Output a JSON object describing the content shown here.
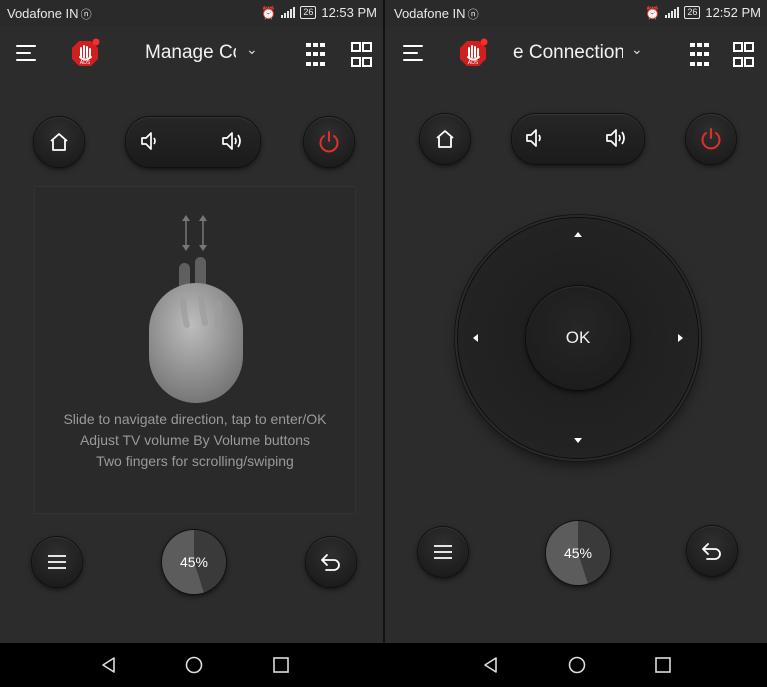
{
  "left": {
    "status": {
      "carrier": "Vodafone IN",
      "battery": "26",
      "time": "12:53 PM"
    },
    "toolbar": {
      "title": "Manage Co",
      "dropdown_icon": "chevron-down-icon"
    },
    "touchpad_hints": [
      "Slide to navigate direction, tap to enter/OK",
      "Adjust TV volume By Volume buttons",
      "Two fingers for scrolling/swiping"
    ],
    "progress": {
      "label": "45%",
      "value": 45
    }
  },
  "right": {
    "status": {
      "carrier": "Vodafone IN",
      "battery": "26",
      "time": "12:52 PM"
    },
    "toolbar": {
      "title": "e Connection",
      "dropdown_icon": "chevron-down-icon"
    },
    "dpad": {
      "ok_label": "OK"
    },
    "progress": {
      "label": "45%",
      "value": 45
    }
  },
  "colors": {
    "power": "#e0302a",
    "background": "#2c2c2c",
    "ads_badge": "#d11f1f"
  },
  "icons": [
    "menu-icon",
    "ads-block-icon",
    "keyboard-icon",
    "apps-grid-icon",
    "home-icon",
    "volume-down-icon",
    "volume-up-icon",
    "power-icon",
    "touch-gesture-icon",
    "back-icon",
    "nav-back-icon",
    "nav-home-icon",
    "nav-recents-icon"
  ]
}
